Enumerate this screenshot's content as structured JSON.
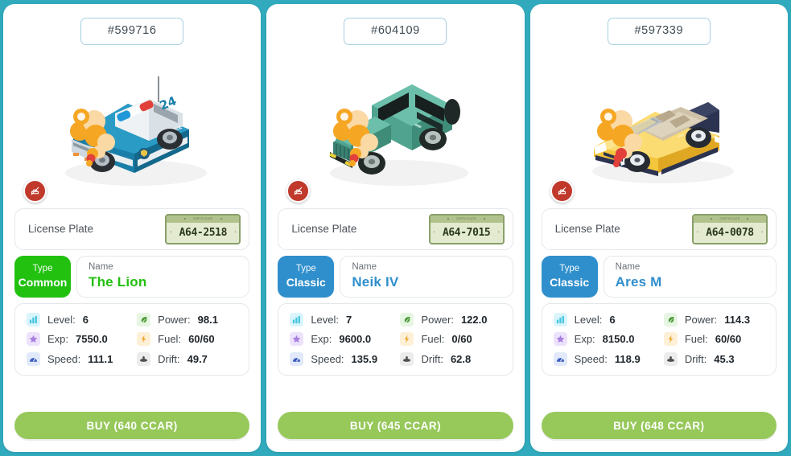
{
  "theme": {
    "background": "#31aabd",
    "card_background": "#ffffff",
    "buy_button": "#96c85a",
    "id_chip_border": "#a7cfe0",
    "plate_bg": "#e3ead0",
    "plate_border": "#8aa06a"
  },
  "stat_icon_colors": {
    "level_bg": "#d9f5fb",
    "level_fg": "#43c3e0",
    "exp_bg": "#ede2fb",
    "exp_fg": "#a97fe0",
    "speed_bg": "#e1e9fb",
    "speed_fg": "#3b5bbd",
    "power_bg": "#e6f6e2",
    "power_fg": "#4f9b3a",
    "fuel_bg": "#fdf0d6",
    "fuel_fg": "#f0a830",
    "drift_bg": "#ececec",
    "drift_fg": "#4d5156"
  },
  "labels": {
    "license_plate": "License Plate",
    "type": "Type",
    "name": "Name",
    "level": "Level:",
    "exp": "Exp:",
    "speed": "Speed:",
    "power": "Power:",
    "fuel": "Fuel:",
    "drift": "Drift:",
    "plate_header": "CERTIFICATE"
  },
  "cards": [
    {
      "id": "#599716",
      "car_art": "police-pickup",
      "badge": "no-photo-badge",
      "plate": "A64-2518",
      "type": "Common",
      "type_color": "#22c110",
      "name": "The Lion",
      "stats": {
        "level": "6",
        "exp": "7550.0",
        "speed": "111.1",
        "power": "98.1",
        "fuel": "60/60",
        "drift": "49.7"
      },
      "buy_label": "BUY (640 CCAR)"
    },
    {
      "id": "#604109",
      "car_art": "green-suv",
      "badge": "no-photo-badge",
      "plate": "A64-7015",
      "type": "Classic",
      "type_color": "#2f8fcc",
      "name": "Neik IV",
      "stats": {
        "level": "7",
        "exp": "9600.0",
        "speed": "135.9",
        "power": "122.0",
        "fuel": "0/60",
        "drift": "62.8"
      },
      "buy_label": "BUY (645 CCAR)"
    },
    {
      "id": "#597339",
      "car_art": "yellow-convertible",
      "badge": "no-photo-badge",
      "plate": "A64-0078",
      "type": "Classic",
      "type_color": "#2f8fcc",
      "name": "Ares M",
      "stats": {
        "level": "6",
        "exp": "8150.0",
        "speed": "118.9",
        "power": "114.3",
        "fuel": "60/60",
        "drift": "45.3"
      },
      "buy_label": "BUY (648 CCAR)"
    }
  ]
}
